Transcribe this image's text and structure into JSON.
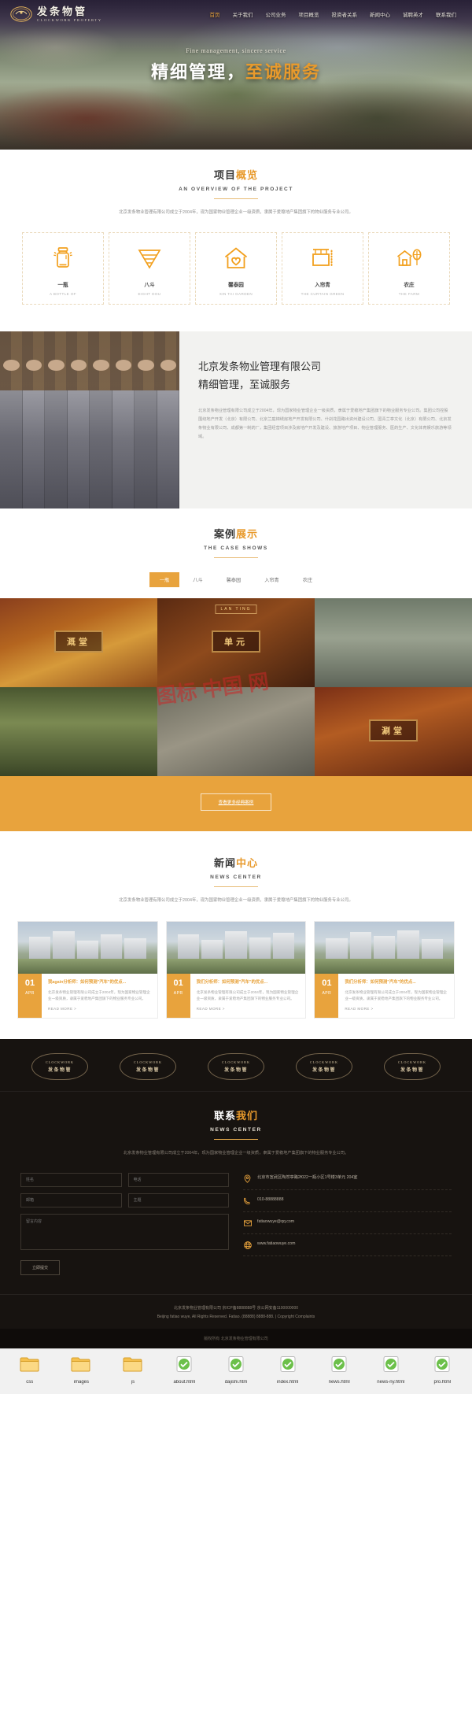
{
  "site": {
    "brand_cn": "发条物管",
    "brand_en": "CLOCKWORK PROPERTY",
    "logo_badge_small": "CLOCKWORK",
    "logo_badge_cn": "发条物管"
  },
  "nav": {
    "items": [
      {
        "label": "首页",
        "active": true
      },
      {
        "label": "关于我们",
        "active": false
      },
      {
        "label": "公司业务",
        "active": false
      },
      {
        "label": "项目概览",
        "active": false
      },
      {
        "label": "投资者关系",
        "active": false
      },
      {
        "label": "新闻中心",
        "active": false
      },
      {
        "label": "诚聘英才",
        "active": false
      },
      {
        "label": "联系我们",
        "active": false
      }
    ]
  },
  "hero": {
    "subtitle": "Fine management, sincere service",
    "title_main": "精细管理，",
    "title_highlight": "至诚服务"
  },
  "overview": {
    "title_main": "项目",
    "title_highlight": "概览",
    "title_en": "AN OVERVIEW OF THE PROJECT",
    "description": "北京发条物业管理有限公司成立于2004年，现为国家物业管理企业一级资质，隶属于爱稳地产集团旗下的物业服务专业公司。",
    "cards": [
      {
        "cn": "一瓶",
        "en": "A BOTTLE OF",
        "icon": "jar-icon"
      },
      {
        "cn": "八斗",
        "en": "EIGHT DOU",
        "icon": "funnel-icon"
      },
      {
        "cn": "馨泰园",
        "en": "XIN TAI GARDEN",
        "icon": "house-heart-icon"
      },
      {
        "cn": "入帘青",
        "en": "THE CURTAIN GREEN",
        "icon": "curtain-icon"
      },
      {
        "cn": "农庄",
        "en": "THE FARM",
        "icon": "farm-icon"
      }
    ]
  },
  "about": {
    "heading": "北京发条物业管理有限公司精细管理，至诚服务",
    "paragraph": "北京发条物业管理有限公司成立于2004年，现为国家物业管理企业一级资质，隶属于爱稳地产集团旗下的物业服务专业公司。集团公司控股围绕地产开发（北京）有限公司、北京兰庭锦绣房地产开发有限公司、什刹花园路出资州建设公司、国青兰亭文化（北京）有限公司、北京发条物业有限公司、成都第一制药厂，集团经营项目涉及房地产开发及建设、旅游地产项目、物业管理服务、医药生产、文化体育娱乐旅游等领域。"
  },
  "cases": {
    "title_main": "案例",
    "title_highlight": "展示",
    "title_en": "THE CASE SHOWS",
    "tabs": [
      {
        "label": "一瓶",
        "active": true
      },
      {
        "label": "八斗",
        "active": false
      },
      {
        "label": "馨泰园",
        "active": false
      },
      {
        "label": "入帘青",
        "active": false
      },
      {
        "label": "农庄",
        "active": false
      }
    ],
    "tiles": [
      {
        "caption": "溉堂",
        "badge": ""
      },
      {
        "caption": "单元",
        "badge": "LAN TING"
      },
      {
        "caption": "",
        "badge": ""
      },
      {
        "caption": "",
        "badge": ""
      },
      {
        "caption": "",
        "badge": ""
      },
      {
        "caption": "涮堂",
        "badge": ""
      }
    ],
    "watermark": "图标 中国 网",
    "more_button": "查看更多经典案例"
  },
  "news": {
    "title_main": "新闻",
    "title_highlight": "中心",
    "title_en": "NEWS CENTER",
    "description": "北京发条物业管理有限公司成立于2004年，现为国家物业管理企业一级资质，隶属于爱稳地产集团旗下的物业服务专业公司。",
    "items": [
      {
        "day": "01",
        "month": "APR",
        "title": "我again分析师：如何预测\"汽车\"的优点...",
        "excerpt": "北京发条物业管理有限公司成立于2004年，现为国家物业管理企业一级资质，隶属于爱稳地产集团旗下的物业服务专业公司。",
        "more": "READ MORE >"
      },
      {
        "day": "01",
        "month": "APR",
        "title": "我们分析师：如何预测\"汽车\"的优点...",
        "excerpt": "北京发条物业管理有限公司成立于2004年，现为国家物业管理企业一级资质，隶属于爱稳地产集团旗下的物业服务专业公司。",
        "more": "READ MORE >"
      },
      {
        "day": "01",
        "month": "APR",
        "title": "我们分析师：如何预测\"汽车\"的优点...",
        "excerpt": "北京发条物业管理有限公司成立于2004年，现为国家物业管理企业一级资质，隶属于爱稳地产集团旗下的物业服务专业公司。",
        "more": "READ MORE >"
      }
    ]
  },
  "contact": {
    "title_main": "联系",
    "title_highlight": "我们",
    "title_en": "NEWS CENTER",
    "description": "北京发条物业管理有限公司成立于2004年，现为国家物业管理企业一级资质，隶属于爱稳地产集团旗下的物业服务专业公司。",
    "form": {
      "name_placeholder": "姓名",
      "phone_placeholder": "电话",
      "email_placeholder": "邮箱",
      "subject_placeholder": "主题",
      "message_placeholder": "留言内容",
      "submit_label": "立即提交"
    },
    "lines": [
      {
        "icon": "location-icon",
        "text": "北京市宣武区陶然亭路2f022一瓶小区1号楼3单元 204室"
      },
      {
        "icon": "phone-icon",
        "text": "010-88888888"
      },
      {
        "icon": "mail-icon",
        "text": "fatiaowuye@qq.com"
      },
      {
        "icon": "globe-icon",
        "text": "www.fatiaowuye.com"
      }
    ]
  },
  "legal": {
    "line1": "北京发条物业管理有限公司 京ICP备8888888号 京公网安备1100000000",
    "line2": "Beijing fatiao wuye, All Rights Reserved. Fatiao. (88888) 8888-888. | Copyright Complaints",
    "line3_a": "版权所有",
    "line3_b": "北京发条物业管理有限公司"
  },
  "colors": {
    "accent": "#e8a33d",
    "dark": "#171310",
    "text": "#333333"
  },
  "files": {
    "items": [
      {
        "name": "css",
        "type": "folder"
      },
      {
        "name": "images",
        "type": "folder"
      },
      {
        "name": "js",
        "type": "folder"
      },
      {
        "name": "about.html",
        "type": "html"
      },
      {
        "name": "dajishi.htm",
        "type": "html"
      },
      {
        "name": "index.html",
        "type": "html"
      },
      {
        "name": "news.html",
        "type": "html"
      },
      {
        "name": "news-ny.html",
        "type": "html"
      },
      {
        "name": "pro.html",
        "type": "html"
      }
    ]
  }
}
